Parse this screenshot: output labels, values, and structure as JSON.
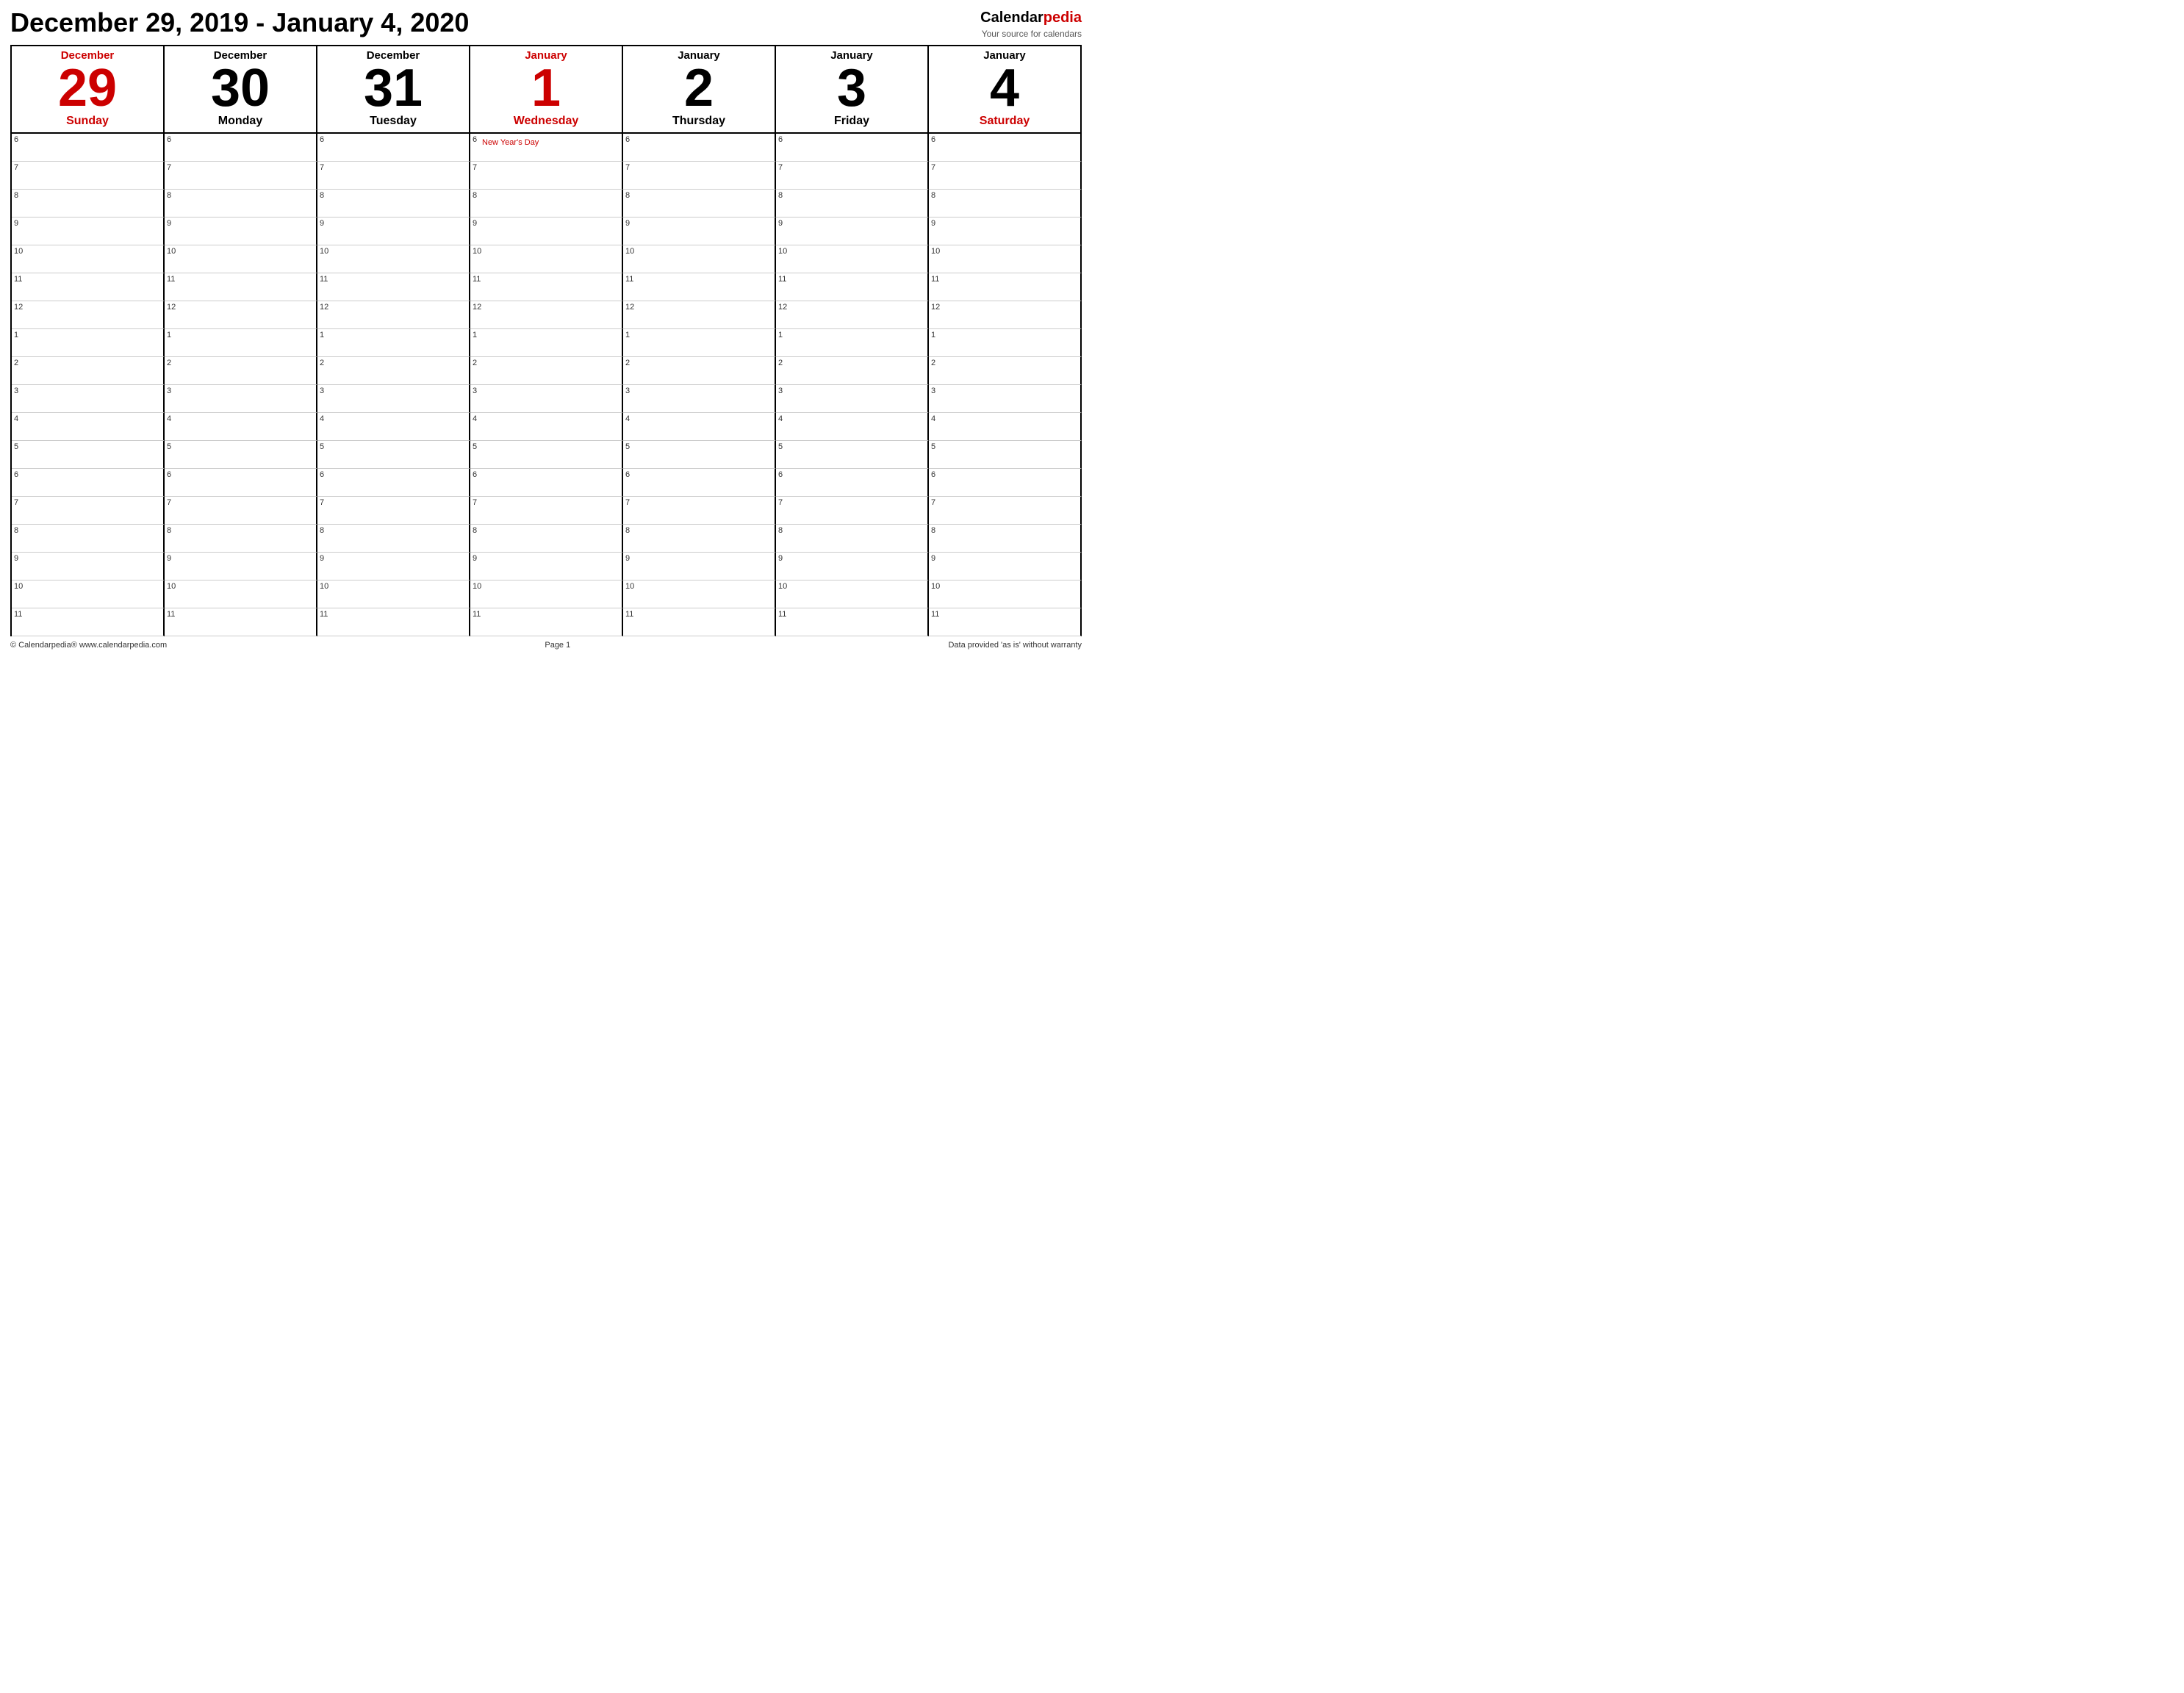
{
  "header": {
    "title": "December 29, 2019 - January 4, 2020"
  },
  "brand": {
    "name_calendar": "Calendar",
    "name_pedia": "pedia",
    "tagline": "Your source for calendars"
  },
  "days": [
    {
      "month": "December",
      "number": "29",
      "name": "Sunday",
      "red": true,
      "month_red": true,
      "name_red": true
    },
    {
      "month": "December",
      "number": "30",
      "name": "Monday",
      "red": false,
      "month_red": false,
      "name_red": false
    },
    {
      "month": "December",
      "number": "31",
      "name": "Tuesday",
      "red": false,
      "month_red": false,
      "name_red": false
    },
    {
      "month": "January",
      "number": "1",
      "name": "Wednesday",
      "red": true,
      "month_red": true,
      "name_red": true
    },
    {
      "month": "January",
      "number": "2",
      "name": "Thursday",
      "red": false,
      "month_red": false,
      "name_red": false
    },
    {
      "month": "January",
      "number": "3",
      "name": "Friday",
      "red": false,
      "month_red": false,
      "name_red": false
    },
    {
      "month": "January",
      "number": "4",
      "name": "Saturday",
      "red": false,
      "month_red": false,
      "name_red": true
    }
  ],
  "time_slots": [
    "6",
    "7",
    "8",
    "9",
    "10",
    "11",
    "12",
    "1",
    "2",
    "3",
    "4",
    "5",
    "6",
    "7",
    "8",
    "9",
    "10",
    "11"
  ],
  "events": {
    "3_0": "New Year's Day"
  },
  "footer": {
    "left": "© Calendarpedia®   www.calendarpedia.com",
    "center": "Page 1",
    "right": "Data provided 'as is' without warranty"
  }
}
